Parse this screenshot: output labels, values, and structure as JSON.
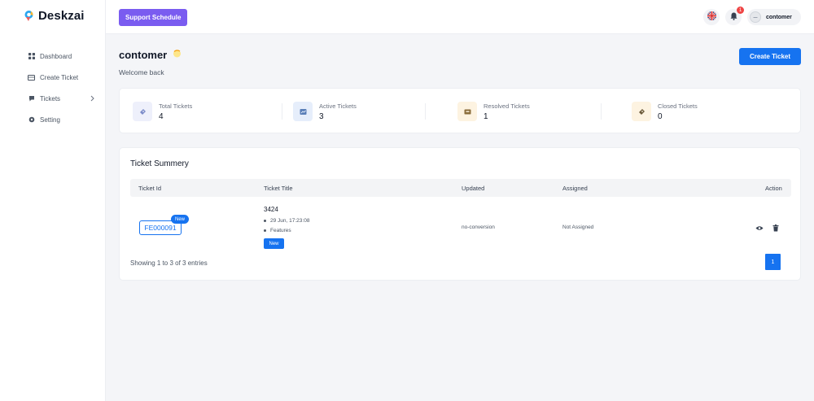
{
  "app": {
    "name": "Deskzai"
  },
  "sidebar": {
    "items": [
      {
        "label": "Dashboard",
        "icon": "grid-icon"
      },
      {
        "label": "Create Ticket",
        "icon": "ticket-icon"
      },
      {
        "label": "Tickets",
        "icon": "chat-icon"
      },
      {
        "label": "Setting",
        "icon": "gear-icon"
      }
    ]
  },
  "topbar": {
    "support_label": "Support Schedule",
    "notification_count": "1",
    "user_name": "contomer"
  },
  "header": {
    "title": "contomer",
    "welcome": "Welcome back",
    "create_label": "Create Ticket"
  },
  "stats": [
    {
      "label": "Total Tickets",
      "value": "4",
      "color": "#eef0fb"
    },
    {
      "label": "Active Tickets",
      "value": "3",
      "color": "#e6eefb"
    },
    {
      "label": "Resolved Tickets",
      "value": "1",
      "color": "#fdf3e1"
    },
    {
      "label": "Closed Tickets",
      "value": "0",
      "color": "#fdf3e1"
    }
  ],
  "summary": {
    "title": "Ticket Summery",
    "columns": [
      "Ticket Id",
      "Ticket Title",
      "Updated",
      "Assigned",
      "Action"
    ],
    "rows": [
      {
        "id": "FE000091",
        "badge": "New",
        "title": "3424",
        "date": "29 Jun, 17:23:08",
        "category": "Features",
        "status": "New",
        "updated": "no-conversion",
        "assigned": "Not Assigned"
      }
    ],
    "showing": "Showing 1 to 3 of 3 entries",
    "page": "1"
  },
  "colors": {
    "accent": "#1673f0",
    "purple": "#7a5cf0"
  }
}
